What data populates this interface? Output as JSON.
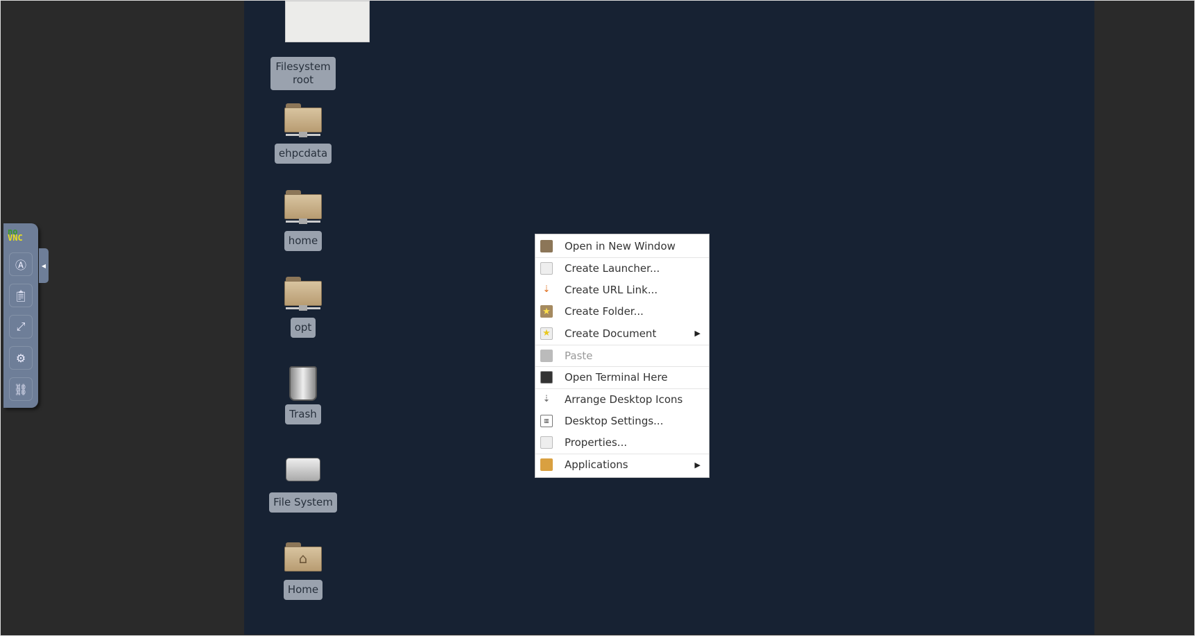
{
  "desktop": {
    "background": "#172233",
    "icons": [
      {
        "label": "Filesystem root",
        "icon": "drive-icon"
      },
      {
        "label": "ehpcdata",
        "icon": "network-folder-icon"
      },
      {
        "label": "home",
        "icon": "network-folder-icon"
      },
      {
        "label": "opt",
        "icon": "network-folder-icon"
      },
      {
        "label": "Trash",
        "icon": "trash-icon"
      },
      {
        "label": "File System",
        "icon": "hard-drive-icon"
      },
      {
        "label": "Home",
        "icon": "home-folder-icon"
      }
    ]
  },
  "context_menu": {
    "items": [
      {
        "label": "Open in New Window",
        "icon": "folder-window-icon"
      },
      {
        "label": "Create Launcher...",
        "icon": "document-icon"
      },
      {
        "label": "Create URL Link...",
        "icon": "link-icon"
      },
      {
        "label": "Create Folder...",
        "icon": "new-folder-icon"
      },
      {
        "label": "Create Document",
        "icon": "new-document-icon",
        "submenu": true
      },
      {
        "label": "Paste",
        "icon": "paste-icon",
        "disabled": true
      },
      {
        "label": "Open Terminal Here",
        "icon": "terminal-icon"
      },
      {
        "label": "Arrange Desktop Icons",
        "icon": "arrange-icon"
      },
      {
        "label": "Desktop Settings...",
        "icon": "settings-icon"
      },
      {
        "label": "Properties...",
        "icon": "properties-icon"
      },
      {
        "label": "Applications",
        "icon": "applications-icon",
        "submenu": true
      }
    ]
  },
  "novnc": {
    "logo_top": "no",
    "logo_bottom": "VNC"
  }
}
